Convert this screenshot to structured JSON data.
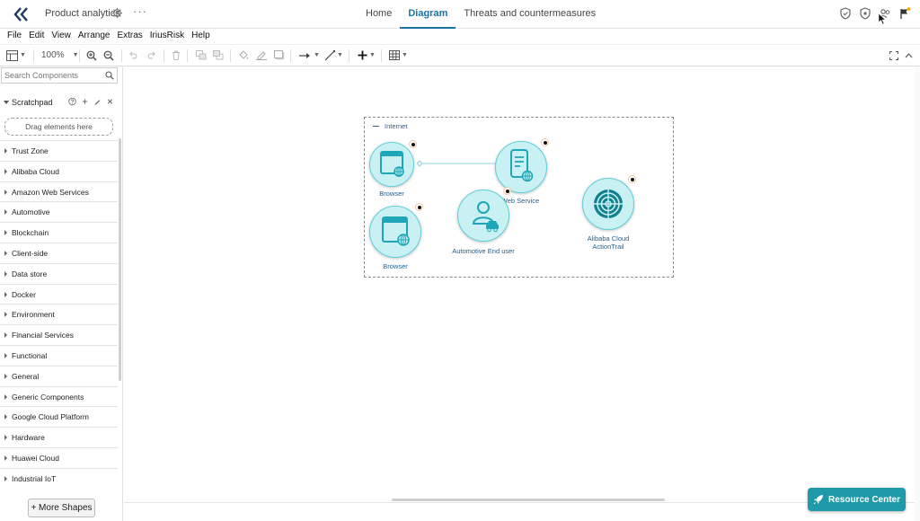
{
  "header": {
    "app_title": "Product analytics",
    "tabs": [
      {
        "label": "Home",
        "active": false
      },
      {
        "label": "Diagram",
        "active": true
      },
      {
        "label": "Threats and countermeasures",
        "active": false
      }
    ],
    "accent_color": "#1a73a6"
  },
  "menu": {
    "items": [
      "File",
      "Edit",
      "View",
      "Arrange",
      "Extras",
      "IriusRisk",
      "Help"
    ]
  },
  "toolbar": {
    "zoom": "100%"
  },
  "sidebar": {
    "search_placeholder": "Search Components",
    "scratchpad_title": "Scratchpad",
    "drop_zone_text": "Drag elements here",
    "categories": [
      "Trust Zone",
      "Alibaba Cloud",
      "Amazon Web Services",
      "Automotive",
      "Blockchain",
      "Client-side",
      "Data store",
      "Docker",
      "Environment",
      "Financial Services",
      "Functional",
      "General",
      "Generic Components",
      "Google Cloud Platform",
      "Hardware",
      "Huawei Cloud",
      "Industrial IoT"
    ],
    "more_shapes_label": "+ More Shapes"
  },
  "diagram": {
    "zone_label": "Internet",
    "nodes": {
      "browser1": "Browser",
      "web_service": "Web Service",
      "browser2": "Browser",
      "automotive_user": "Automotive End user",
      "actiontrail": "Alibaba Cloud ActionTrail"
    },
    "node_fill": "#c9f1f4",
    "node_icon_color": "#1ea5b8"
  },
  "resource_center": {
    "label": "Resource Center",
    "color": "#1f9aa8"
  }
}
